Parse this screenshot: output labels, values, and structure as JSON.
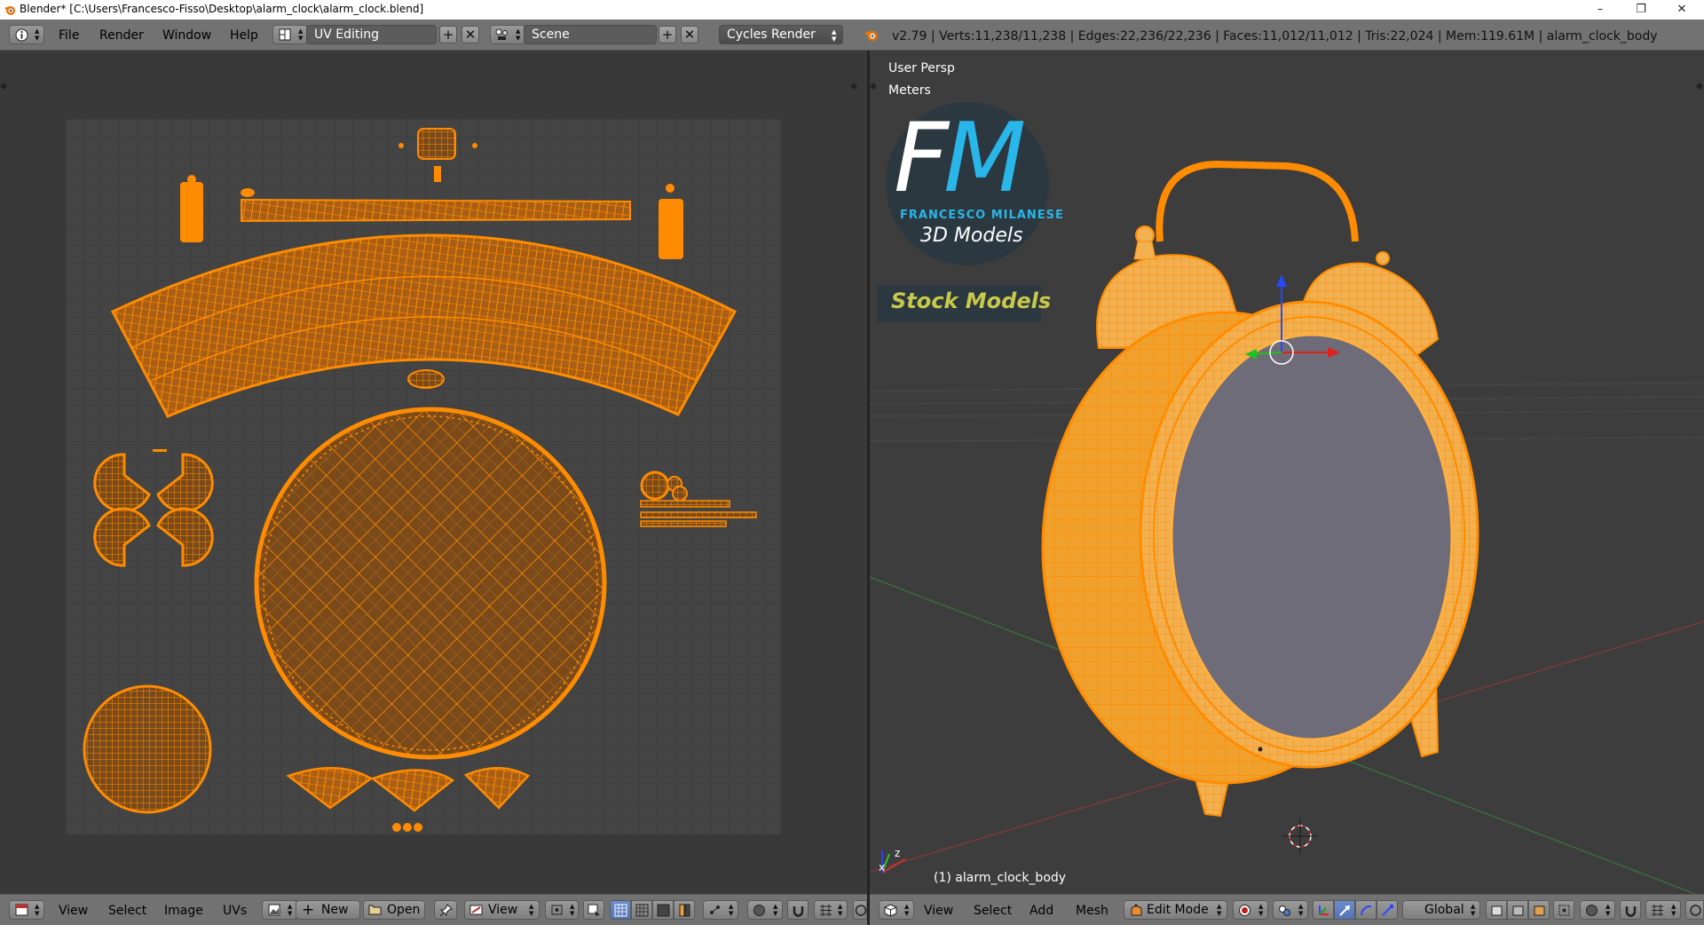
{
  "window": {
    "title": "Blender* [C:\\Users\\Francesco-Fisso\\Desktop\\alarm_clock\\alarm_clock.blend]",
    "controls": [
      "minimize-icon",
      "restore-icon",
      "close-icon"
    ]
  },
  "info_header": {
    "menus": [
      "File",
      "Render",
      "Window",
      "Help"
    ],
    "screen_layout": "UV Editing",
    "scene": "Scene",
    "render_engine": "Cycles Render",
    "stats": "v2.79 | Verts:11,238/11,238 | Edges:22,236/22,236 | Faces:11,012/11,012 | Tris:22,024 | Mem:119.61M | alarm_clock_body"
  },
  "uv_editor": {
    "menus": [
      "View",
      "Select",
      "Image",
      "UVs"
    ],
    "new_label": "New",
    "open_label": "Open",
    "view_label": "View"
  },
  "viewport": {
    "view_name": "User Persp",
    "units": "Meters",
    "object_label": "(1) alarm_clock_body",
    "menus": [
      "View",
      "Select",
      "Add",
      "Mesh"
    ],
    "mode": "Edit Mode",
    "orientation": "Global",
    "axis_labels": {
      "x": "x",
      "z": "z"
    }
  },
  "watermark": {
    "logo_letters": "FM",
    "author": "FRANCESCO MILANESE",
    "subtitle": "3D Models",
    "banner": "Stock Models"
  },
  "colors": {
    "accent": "#ff8c00",
    "uv_grid_bg": "#444444",
    "header_bg": "#727272",
    "clock_face": "#6e6c78",
    "watermark_cyan": "#29b6e8",
    "banner_yellow": "#c8c84a"
  }
}
